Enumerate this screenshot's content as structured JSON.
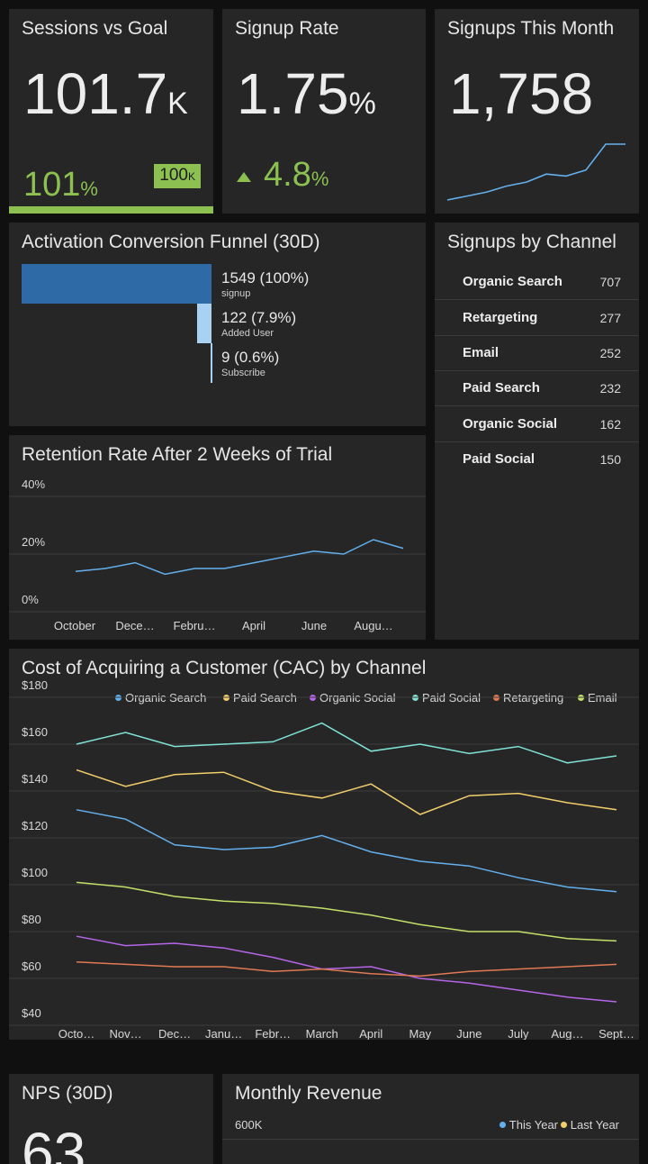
{
  "sessions": {
    "title": "Sessions vs Goal",
    "value": "101.7",
    "value_suffix": "K",
    "percent": "101",
    "percent_suffix": "%",
    "goal": "100",
    "goal_suffix": "K",
    "progress": 1.0
  },
  "signup_rate": {
    "title": "Signup Rate",
    "value": "1.75",
    "value_suffix": "%",
    "change": "4.8",
    "change_suffix": "%"
  },
  "signups_month": {
    "title": "Signups This Month",
    "value": "1,758",
    "sparkline": [
      2,
      4,
      6,
      9,
      11,
      15,
      14,
      17,
      30,
      30
    ]
  },
  "funnel": {
    "title": "Activation Conversion Funnel (30D)",
    "steps": [
      {
        "value": "1549 (100%)",
        "label": "signup",
        "ratio": 1.0
      },
      {
        "value": "122 (7.9%)",
        "label": "Added User",
        "ratio": 0.079
      },
      {
        "value": "9 (0.6%)",
        "label": "Subscribe",
        "ratio": 0.006
      }
    ]
  },
  "channels": {
    "title": "Signups by Channel",
    "rows": [
      {
        "name": "Organic Search",
        "value": "707"
      },
      {
        "name": "Retargeting",
        "value": "277"
      },
      {
        "name": "Email",
        "value": "252"
      },
      {
        "name": "Paid Search",
        "value": "232"
      },
      {
        "name": "Organic Social",
        "value": "162"
      },
      {
        "name": "Paid Social",
        "value": "150"
      }
    ]
  },
  "retention": {
    "title": "Retention Rate After 2 Weeks of Trial",
    "chart_data": {
      "type": "line",
      "y_ticks": [
        "40%",
        "20%",
        "0%"
      ],
      "ylim": [
        0,
        40
      ],
      "x_labels": [
        "October",
        "Dece…",
        "Febru…",
        "April",
        "June",
        "Augu…"
      ],
      "values": [
        14,
        15,
        17,
        13,
        15,
        15,
        17,
        19,
        21,
        20,
        25,
        22
      ],
      "color": "#64b0ee"
    }
  },
  "cac": {
    "title": "Cost of Acquiring a Customer (CAC) by Channel",
    "chart_data": {
      "type": "line",
      "y_ticks": [
        "$180",
        "$160",
        "$140",
        "$120",
        "$100",
        "$80",
        "$60",
        "$40"
      ],
      "ylim": [
        40,
        180
      ],
      "x_labels": [
        "Octo…",
        "Nov…",
        "Dec…",
        "Janu…",
        "Febr…",
        "March",
        "April",
        "May",
        "June",
        "July",
        "Aug…",
        "Sept…"
      ],
      "series": [
        {
          "name": "Organic Search",
          "color": "#64b0ee",
          "values": [
            132,
            128,
            117,
            115,
            116,
            121,
            114,
            110,
            108,
            103,
            99,
            97
          ]
        },
        {
          "name": "Paid Search",
          "color": "#f2cf6b",
          "values": [
            149,
            142,
            147,
            148,
            140,
            137,
            143,
            130,
            138,
            139,
            135,
            132
          ]
        },
        {
          "name": "Organic Social",
          "color": "#b566e8",
          "values": [
            78,
            74,
            75,
            73,
            69,
            64,
            65,
            60,
            58,
            55,
            52,
            50
          ]
        },
        {
          "name": "Paid Social",
          "color": "#7fe3d6",
          "values": [
            160,
            165,
            159,
            160,
            161,
            169,
            157,
            160,
            156,
            159,
            152,
            155
          ]
        },
        {
          "name": "Retargeting",
          "color": "#e07a55",
          "values": [
            67,
            66,
            65,
            65,
            63,
            64,
            62,
            61,
            63,
            64,
            65,
            66
          ]
        },
        {
          "name": "Email",
          "color": "#c2e06a",
          "values": [
            101,
            99,
            95,
            93,
            92,
            90,
            87,
            83,
            80,
            80,
            77,
            76
          ]
        }
      ]
    }
  },
  "nps": {
    "title": "NPS (30D)",
    "value": "63"
  },
  "revenue": {
    "title": "Monthly Revenue",
    "y_top": "600K",
    "legend": [
      {
        "name": "This Year",
        "color": "#64b0ee"
      },
      {
        "name": "Last Year",
        "color": "#f2cf6b"
      }
    ]
  }
}
